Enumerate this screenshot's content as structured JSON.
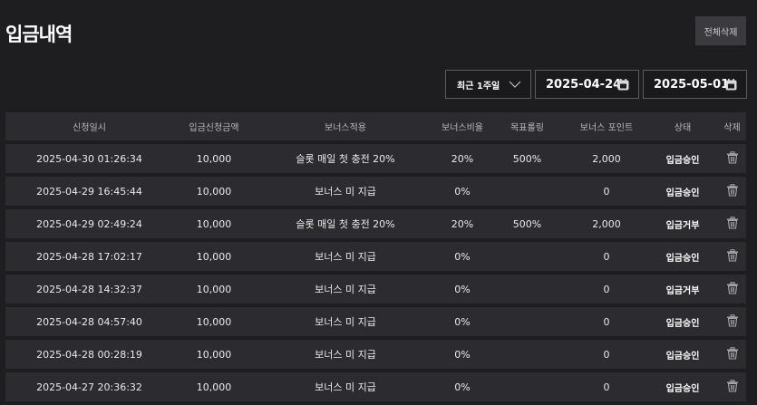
{
  "page": {
    "title": "입금내역",
    "delete_all_label": "전체삭제"
  },
  "filters": {
    "period": "최근 1주일",
    "date_from": "2025-04-24",
    "date_to": "2025-05-01"
  },
  "table": {
    "columns": [
      "신청일시",
      "입금신청금액",
      "보너스적용",
      "보너스비율",
      "목표롤링",
      "보너스 포인트",
      "상태",
      "삭제"
    ],
    "rows": [
      {
        "datetime": "2025-04-30 01:26:34",
        "amount": "10,000",
        "bonus": "슬롯 매일 첫 충전 20%",
        "ratio": "20%",
        "rolling": "500%",
        "points": "2,000",
        "status": "입금승인"
      },
      {
        "datetime": "2025-04-29 16:45:44",
        "amount": "10,000",
        "bonus": "보너스 미 지급",
        "ratio": "0%",
        "rolling": "",
        "points": "0",
        "status": "입금승인"
      },
      {
        "datetime": "2025-04-29 02:49:24",
        "amount": "10,000",
        "bonus": "슬롯 매일 첫 충전 20%",
        "ratio": "20%",
        "rolling": "500%",
        "points": "2,000",
        "status": "입금거부"
      },
      {
        "datetime": "2025-04-28 17:02:17",
        "amount": "10,000",
        "bonus": "보너스 미 지급",
        "ratio": "0%",
        "rolling": "",
        "points": "0",
        "status": "입금승인"
      },
      {
        "datetime": "2025-04-28 14:32:37",
        "amount": "10,000",
        "bonus": "보너스 미 지급",
        "ratio": "0%",
        "rolling": "",
        "points": "0",
        "status": "입금거부"
      },
      {
        "datetime": "2025-04-28 04:57:40",
        "amount": "10,000",
        "bonus": "보너스 미 지급",
        "ratio": "0%",
        "rolling": "",
        "points": "0",
        "status": "입금승인"
      },
      {
        "datetime": "2025-04-28 00:28:19",
        "amount": "10,000",
        "bonus": "보너스 미 지급",
        "ratio": "0%",
        "rolling": "",
        "points": "0",
        "status": "입금승인"
      },
      {
        "datetime": "2025-04-27 20:36:32",
        "amount": "10,000",
        "bonus": "보너스 미 지급",
        "ratio": "0%",
        "rolling": "",
        "points": "0",
        "status": "입금승인"
      }
    ]
  },
  "icons": {
    "period_dropdown": "chevron-down-icon",
    "date_picker": "calendar-icon",
    "row_delete": "trash-icon"
  }
}
